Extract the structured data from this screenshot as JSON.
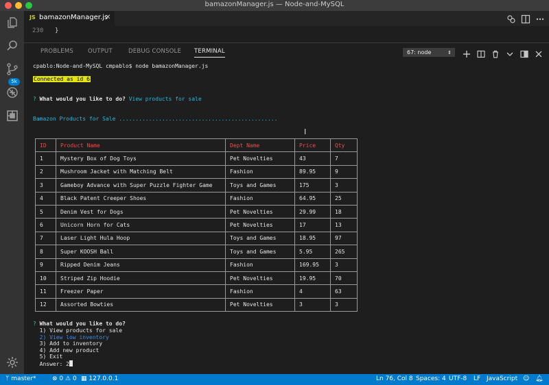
{
  "window": {
    "title": "bamazonManager.js — Node-and-MySQL"
  },
  "activity_bar": {
    "items": [
      "files-icon",
      "search-icon",
      "source-control-icon",
      "debug-icon",
      "extensions-icon",
      "gear-icon"
    ],
    "scm_badge": "5k"
  },
  "editor": {
    "tab": {
      "icon_text": "JS",
      "label": "bamazonManager.js"
    },
    "line_number": "230",
    "line_text": "}"
  },
  "panel": {
    "tabs": [
      "PROBLEMS",
      "OUTPUT",
      "DEBUG CONSOLE",
      "TERMINAL"
    ],
    "active_tab": "TERMINAL",
    "terminal_select": "67: node"
  },
  "terminal": {
    "prompt": "cpablo:Node-and-MySQL cmpablo$ node bamazonManager.js",
    "connected": "Connected as id 6",
    "q1_mark": "?",
    "q1_text": "What would you like to do?",
    "q1_answer": "View products for sale",
    "section_title": "Bamazon Products for Sale ................................................",
    "table": {
      "headers": [
        "ID",
        "Product Name",
        "Dept Name",
        "Price",
        "Qty"
      ],
      "rows": [
        [
          "1",
          "Mystery Box of Dog Toys",
          "Pet Novelties",
          "43",
          "7"
        ],
        [
          "2",
          "Mushroom Jacket with Matching Belt",
          "Fashion",
          "89.95",
          "9"
        ],
        [
          "3",
          "Gameboy Advance with Super Puzzle Fighter Game",
          "Toys and Games",
          "175",
          "3"
        ],
        [
          "4",
          "Black Patent Creeper Shoes",
          "Fashion",
          "64.95",
          "25"
        ],
        [
          "5",
          "Denim Vest for Dogs",
          "Pet Novelties",
          "29.99",
          "18"
        ],
        [
          "6",
          "Unicorn Horn for Cats",
          "Pet Novelties",
          "17",
          "13"
        ],
        [
          "7",
          "Laser Light Hula Hoop",
          "Toys and Games",
          "18.95",
          "97"
        ],
        [
          "8",
          "Super KOOSH Ball",
          "Toys and Games",
          "5.95",
          "265"
        ],
        [
          "9",
          "Ripped Denim Jeans",
          "Fashion",
          "169.95",
          "3"
        ],
        [
          "10",
          "Striped Zip Hoodie",
          "Pet Novelties",
          "19.95",
          "70"
        ],
        [
          "11",
          "Freezer Paper",
          "Fashion",
          "4",
          "63"
        ],
        [
          "12",
          "Assorted Bowties",
          "Pet Novelties",
          "3",
          "3"
        ]
      ]
    },
    "q2_mark": "?",
    "q2_text": "What would you like to do?",
    "menu": [
      "1) View products for sale",
      "2) View low inventory",
      "3) Add to inventory",
      "4) Add new product",
      "5) Exit"
    ],
    "answer_label": "Answer: ",
    "answer_value": "2"
  },
  "statusbar": {
    "branch": "master*",
    "errors": "0",
    "warnings": "0",
    "host": "127.0.0.1",
    "position": "Ln 76, Col 8",
    "indent": "Spaces: 4",
    "encoding": "UTF-8",
    "eol": "LF",
    "language": "JavaScript"
  },
  "colors": {
    "accent": "#007acc",
    "header_red": "#f14c4c",
    "highlight": "#e5e510",
    "link_blue": "#29b8db"
  }
}
